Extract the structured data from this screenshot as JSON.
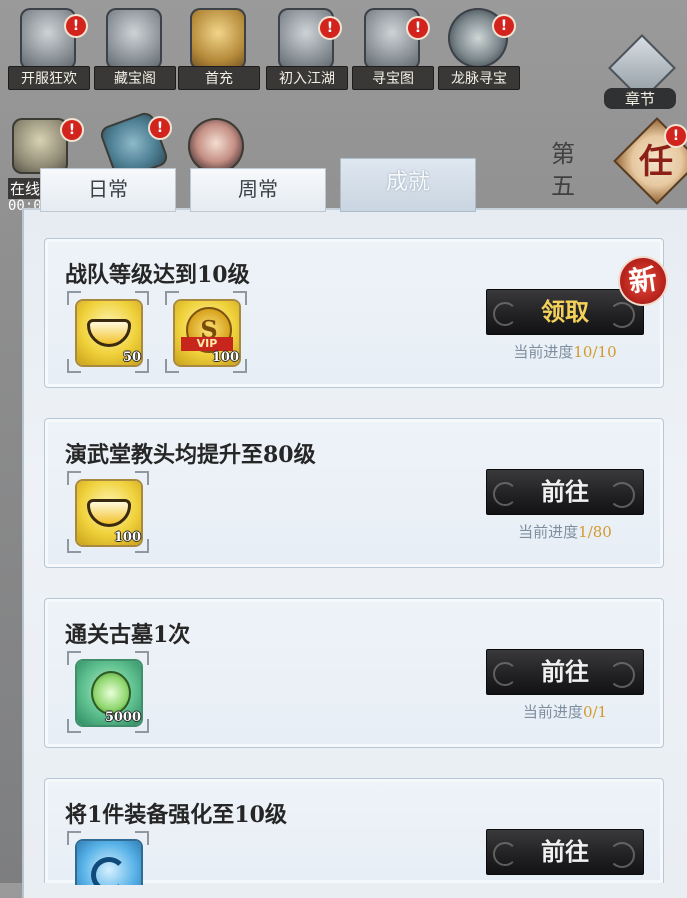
{
  "top_events": [
    {
      "label": "开服狂欢",
      "badge": "!"
    },
    {
      "label": "藏宝阁",
      "badge": "!"
    },
    {
      "label": "首充",
      "badge": "!"
    },
    {
      "label": "初入江湖",
      "badge": "!"
    },
    {
      "label": "寻宝图",
      "badge": "!"
    },
    {
      "label": "龙脉寻宝",
      "badge": "!"
    }
  ],
  "chapter": {
    "label": "章节"
  },
  "side": {
    "ink_text": "第五",
    "task_char": "任",
    "task_badge": "!"
  },
  "row2": {
    "badge1": "!",
    "badge2": "!",
    "peek_label": "在线",
    "peek_time": "00:0"
  },
  "tabs": [
    {
      "label": "日常",
      "active": false
    },
    {
      "label": "周常",
      "active": false
    },
    {
      "label": "成就",
      "active": true
    }
  ],
  "new_badge": "新",
  "tasks": [
    {
      "title": "战队等级达到10级",
      "rewards": [
        {
          "icon": "gold-ingot-icon",
          "qty": "50"
        },
        {
          "icon": "vip-coin-icon",
          "qty": "100",
          "ribbon": "VIP",
          "coin": "S"
        }
      ],
      "button": "领取",
      "progress_label": "当前进度",
      "progress_value": "10/10",
      "claimable": true
    },
    {
      "title": "演武堂教头均提升至80级",
      "rewards": [
        {
          "icon": "gold-ingot-icon",
          "qty": "100"
        }
      ],
      "button": "前往",
      "progress_label": "当前进度",
      "progress_value": "1/80",
      "claimable": false
    },
    {
      "title": "通关古墓1次",
      "rewards": [
        {
          "icon": "jade-token-icon",
          "qty": "5000"
        }
      ],
      "button": "前往",
      "progress_label": "当前进度",
      "progress_value": "0/1",
      "claimable": false
    },
    {
      "title": "将1件装备强化至10级",
      "rewards": [
        {
          "icon": "blue-swirl-icon",
          "qty": ""
        }
      ],
      "button": "前往",
      "progress_label": "",
      "progress_value": "",
      "claimable": false
    }
  ]
}
